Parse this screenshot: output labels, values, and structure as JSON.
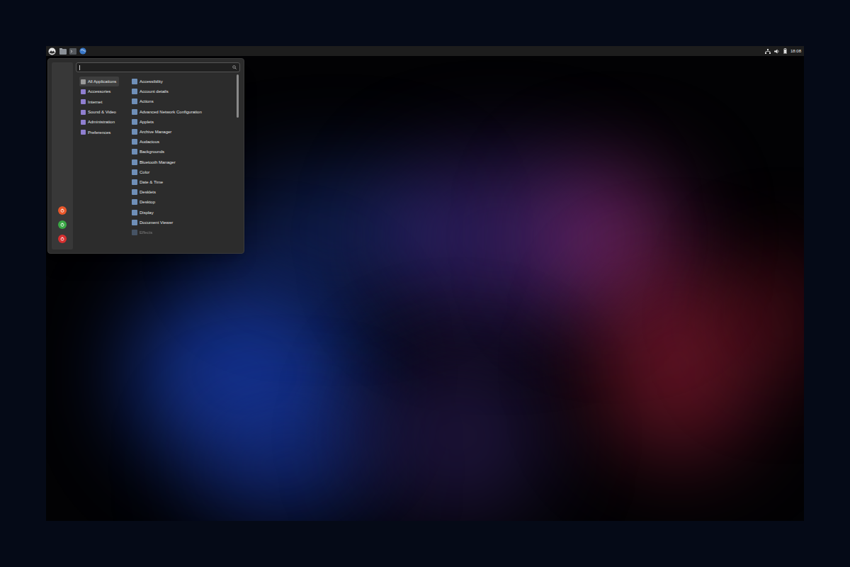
{
  "panel": {
    "clock": "18:08"
  },
  "menu": {
    "categories": [
      {
        "label": "All Applications",
        "selected": true
      },
      {
        "label": "Accessories",
        "selected": false
      },
      {
        "label": "Internet",
        "selected": false
      },
      {
        "label": "Sound & Video",
        "selected": false
      },
      {
        "label": "Administration",
        "selected": false
      },
      {
        "label": "Preferences",
        "selected": false
      }
    ],
    "applications": [
      {
        "label": "Accessibility",
        "faded": false
      },
      {
        "label": "Account details",
        "faded": false
      },
      {
        "label": "Actions",
        "faded": false
      },
      {
        "label": "Advanced Network Configuration",
        "faded": false
      },
      {
        "label": "Applets",
        "faded": false
      },
      {
        "label": "Archive Manager",
        "faded": false
      },
      {
        "label": "Audacious",
        "faded": false
      },
      {
        "label": "Backgrounds",
        "faded": false
      },
      {
        "label": "Bluetooth Manager",
        "faded": false
      },
      {
        "label": "Color",
        "faded": false
      },
      {
        "label": "Date & Time",
        "faded": false
      },
      {
        "label": "Desklets",
        "faded": false
      },
      {
        "label": "Desktop",
        "faded": false
      },
      {
        "label": "Display",
        "faded": false
      },
      {
        "label": "Document Viewer",
        "faded": false
      },
      {
        "label": "Effects",
        "faded": true
      }
    ],
    "scrollbar": {
      "level": 0.25
    },
    "session_buttons": [
      {
        "color": "#e8572a"
      },
      {
        "color": "#3aa845"
      },
      {
        "color": "#d62f2f"
      }
    ]
  }
}
